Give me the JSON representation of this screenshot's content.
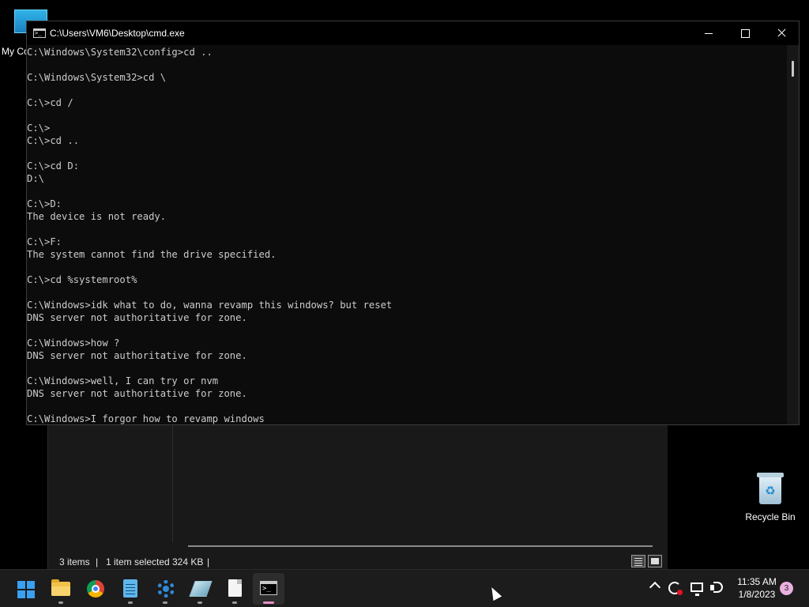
{
  "desktop": {
    "my_computer_label": "My Co",
    "recycle_bin_label": "Recycle Bin"
  },
  "explorer": {
    "status_items": "3 items",
    "status_sep1": "|",
    "status_selected": "1 item selected",
    "status_size": "324 KB",
    "status_sep2": "|"
  },
  "cmd": {
    "title": "C:\\Users\\VM6\\Desktop\\cmd.exe",
    "lines": [
      "C:\\Windows\\System32\\config>cd ..",
      "",
      "C:\\Windows\\System32>cd \\",
      "",
      "C:\\>cd /",
      "",
      "C:\\>",
      "C:\\>cd ..",
      "",
      "C:\\>cd D:",
      "D:\\",
      "",
      "C:\\>D:",
      "The device is not ready.",
      "",
      "C:\\>F:",
      "The system cannot find the drive specified.",
      "",
      "C:\\>cd %systemroot%",
      "",
      "C:\\Windows>idk what to do, wanna revamp this windows? but reset",
      "DNS server not authoritative for zone.",
      "",
      "C:\\Windows>how ?",
      "DNS server not authoritative for zone.",
      "",
      "C:\\Windows>well, I can try or nvm",
      "DNS server not authoritative for zone.",
      "",
      "C:\\Windows>I forgor how to revamp windows"
    ]
  },
  "taskbar": {
    "apps": [
      "start-icon",
      "file-explorer-icon",
      "chrome-icon",
      "notepad-icon",
      "settings-gear-icon",
      "registry-editor-icon",
      "document-icon",
      "terminal-icon"
    ],
    "clock_time": "11:35 AM",
    "clock_date": "1/8/2023",
    "notification_count": "3",
    "active_indicator_color": "#e68fc6"
  }
}
